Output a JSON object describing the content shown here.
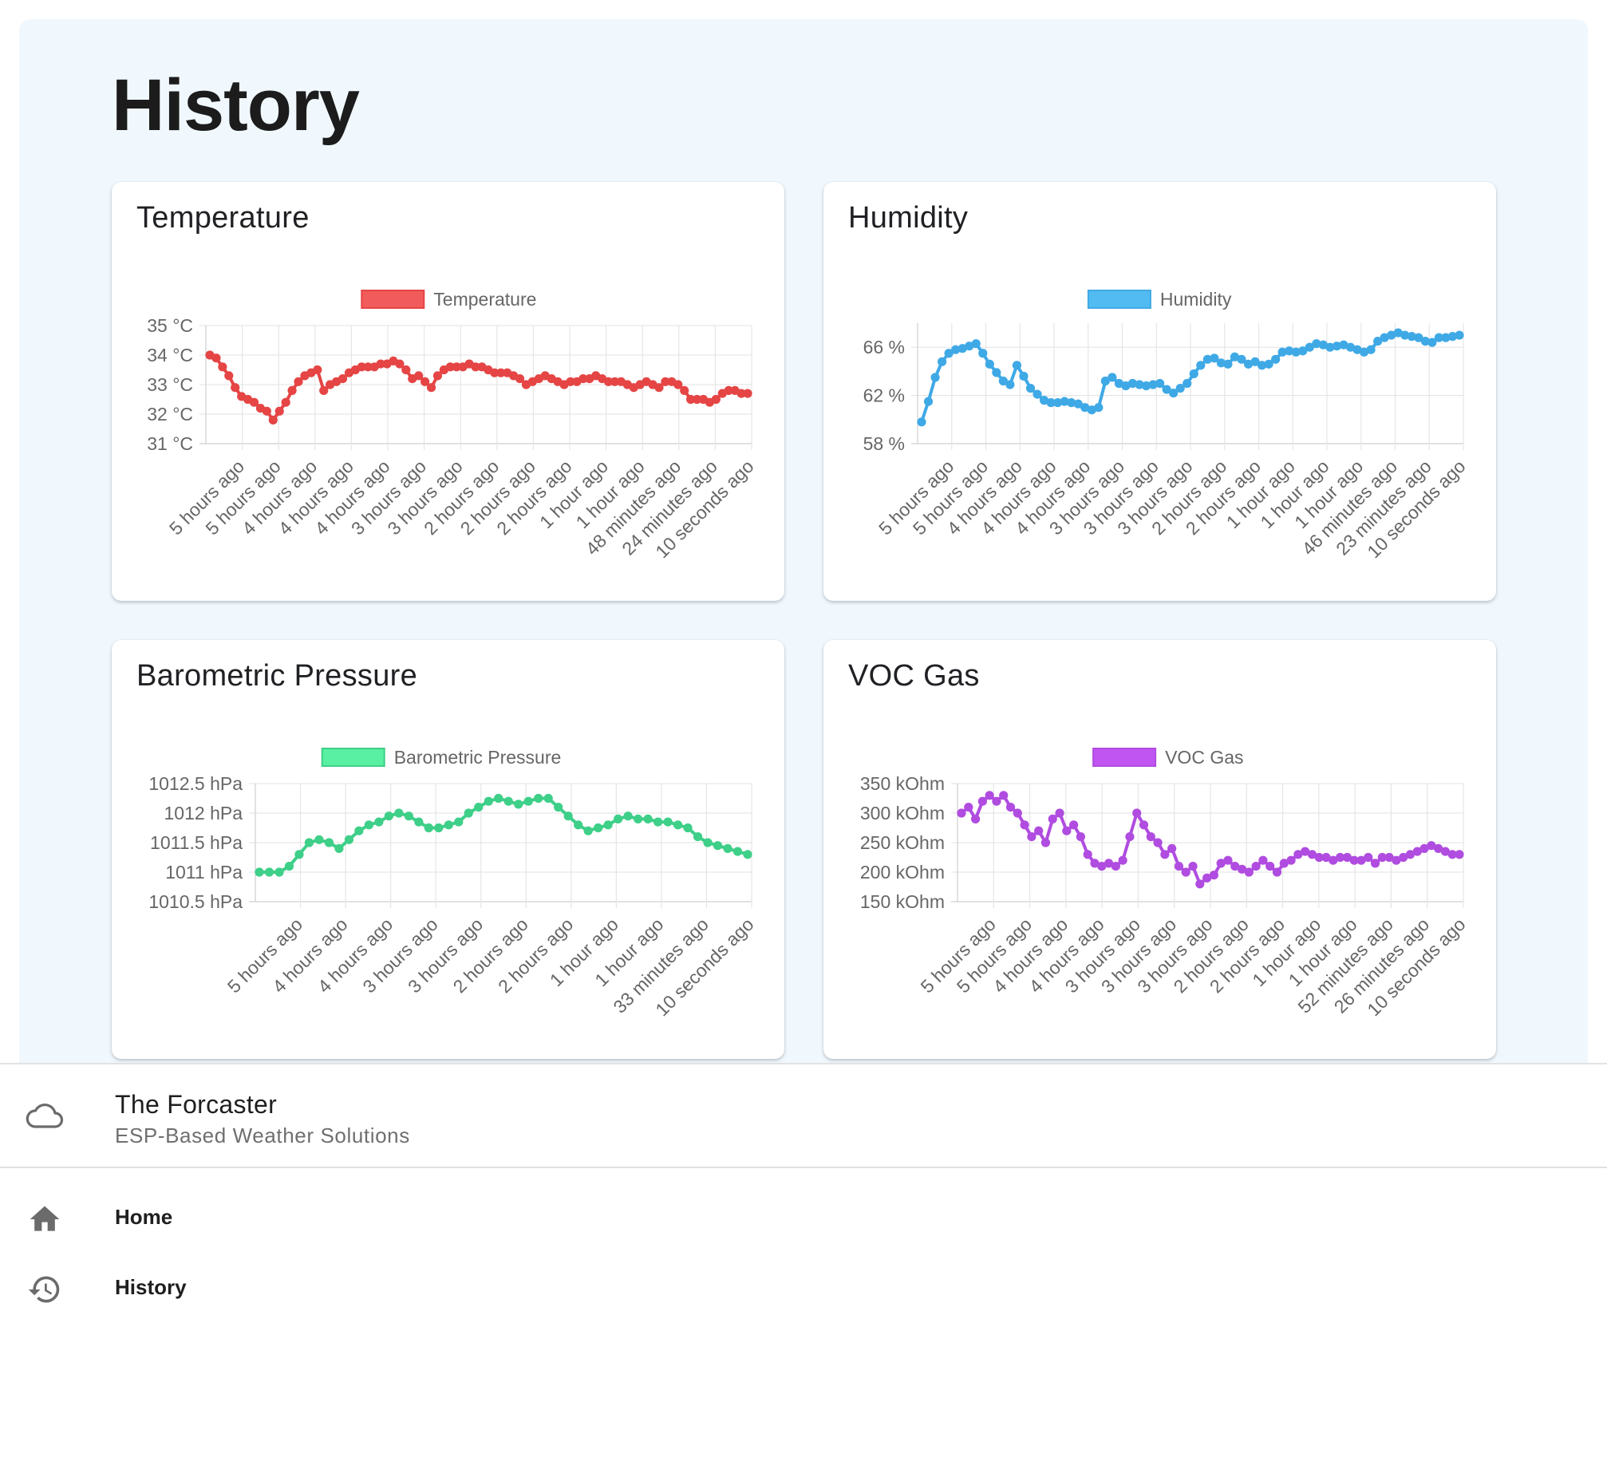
{
  "page": {
    "title": "History"
  },
  "charts": [
    {
      "id": "temperature",
      "card_title": "Temperature",
      "color": "#e54545",
      "legend_fill": "#f25b5b",
      "chart_data": {
        "type": "line",
        "title": "Temperature",
        "series": [
          {
            "name": "Temperature",
            "values": [
              34.0,
              33.9,
              33.6,
              33.3,
              32.9,
              32.6,
              32.5,
              32.4,
              32.2,
              32.1,
              31.8,
              32.1,
              32.4,
              32.8,
              33.1,
              33.3,
              33.4,
              33.5,
              32.8,
              33.0,
              33.1,
              33.2,
              33.4,
              33.5,
              33.6,
              33.6,
              33.6,
              33.7,
              33.7,
              33.8,
              33.7,
              33.5,
              33.2,
              33.3,
              33.1,
              32.9,
              33.3,
              33.5,
              33.6,
              33.6,
              33.6,
              33.7,
              33.6,
              33.6,
              33.5,
              33.4,
              33.4,
              33.4,
              33.3,
              33.2,
              33.0,
              33.1,
              33.2,
              33.3,
              33.2,
              33.1,
              33.0,
              33.1,
              33.1,
              33.2,
              33.2,
              33.3,
              33.2,
              33.1,
              33.1,
              33.1,
              33.0,
              32.9,
              33.0,
              33.1,
              33.0,
              32.9,
              33.1,
              33.1,
              33.0,
              32.8,
              32.5,
              32.5,
              32.5,
              32.4,
              32.5,
              32.7,
              32.8,
              32.8,
              32.7,
              32.7
            ]
          }
        ],
        "x_tick_labels": [
          "5 hours ago",
          "5 hours ago",
          "4 hours ago",
          "4 hours ago",
          "4 hours ago",
          "3 hours ago",
          "3 hours ago",
          "2 hours ago",
          "2 hours ago",
          "2 hours ago",
          "1 hour ago",
          "1 hour ago",
          "48 minutes ago",
          "24 minutes ago",
          "10 seconds ago"
        ],
        "y_ticks": [
          31,
          32,
          33,
          34,
          35
        ],
        "y_tick_labels": [
          "31 °C",
          "32 °C",
          "33 °C",
          "34 °C",
          "35 °C"
        ],
        "ylim": [
          31,
          35
        ],
        "grid": true,
        "legend": "top"
      }
    },
    {
      "id": "humidity",
      "card_title": "Humidity",
      "color": "#3fa9e6",
      "legend_fill": "#52bcf2",
      "chart_data": {
        "type": "line",
        "title": "Humidity",
        "series": [
          {
            "name": "Humidity",
            "values": [
              59.8,
              61.5,
              63.5,
              64.8,
              65.5,
              65.8,
              65.9,
              66.1,
              66.3,
              65.5,
              64.6,
              63.9,
              63.2,
              62.9,
              64.5,
              63.6,
              62.6,
              62.1,
              61.6,
              61.4,
              61.4,
              61.5,
              61.4,
              61.3,
              61.0,
              60.8,
              61.0,
              63.2,
              63.5,
              63.0,
              62.8,
              63.0,
              62.9,
              62.8,
              62.9,
              63.0,
              62.5,
              62.2,
              62.6,
              63.0,
              63.8,
              64.5,
              65.0,
              65.1,
              64.7,
              64.6,
              65.2,
              65.0,
              64.6,
              64.8,
              64.5,
              64.6,
              65.0,
              65.6,
              65.7,
              65.6,
              65.7,
              66.0,
              66.3,
              66.2,
              66.0,
              66.1,
              66.2,
              66.0,
              65.8,
              65.6,
              65.8,
              66.5,
              66.8,
              67.0,
              67.2,
              67.0,
              66.9,
              66.8,
              66.5,
              66.4,
              66.8,
              66.8,
              66.9,
              67.0
            ]
          }
        ],
        "x_tick_labels": [
          "5 hours ago",
          "5 hours ago",
          "4 hours ago",
          "4 hours ago",
          "4 hours ago",
          "3 hours ago",
          "3 hours ago",
          "3 hours ago",
          "2 hours ago",
          "2 hours ago",
          "1 hour ago",
          "1 hour ago",
          "1 hour ago",
          "46 minutes ago",
          "23 minutes ago",
          "10 seconds ago"
        ],
        "y_ticks": [
          58,
          62,
          66
        ],
        "y_tick_labels": [
          "58 %",
          "62 %",
          "66 %"
        ],
        "ylim": [
          58,
          68
        ],
        "grid": true,
        "legend": "top"
      }
    },
    {
      "id": "pressure",
      "card_title": "Barometric Pressure",
      "color": "#3ecf88",
      "legend_fill": "#59f0a3",
      "chart_data": {
        "type": "line",
        "title": "Barometric Pressure",
        "series": [
          {
            "name": "Barometric Pressure",
            "values": [
              1011.0,
              1011.0,
              1011.0,
              1011.1,
              1011.3,
              1011.5,
              1011.55,
              1011.5,
              1011.4,
              1011.55,
              1011.7,
              1011.8,
              1011.85,
              1011.95,
              1012.0,
              1011.95,
              1011.85,
              1011.75,
              1011.75,
              1011.8,
              1011.85,
              1012.0,
              1012.1,
              1012.2,
              1012.25,
              1012.2,
              1012.15,
              1012.2,
              1012.25,
              1012.25,
              1012.1,
              1011.95,
              1011.8,
              1011.7,
              1011.75,
              1011.8,
              1011.9,
              1011.95,
              1011.9,
              1011.9,
              1011.85,
              1011.85,
              1011.8,
              1011.75,
              1011.6,
              1011.5,
              1011.45,
              1011.4,
              1011.35,
              1011.3
            ]
          }
        ],
        "x_tick_labels": [
          "5 hours ago",
          "4 hours ago",
          "4 hours ago",
          "3 hours ago",
          "3 hours ago",
          "2 hours ago",
          "2 hours ago",
          "1 hour ago",
          "1 hour ago",
          "33 minutes ago",
          "10 seconds ago"
        ],
        "y_ticks": [
          1010.5,
          1011,
          1011.5,
          1012,
          1012.5
        ],
        "y_tick_labels": [
          "1010.5 hPa",
          "1011 hPa",
          "1011.5 hPa",
          "1012 hPa",
          "1012.5 hPa"
        ],
        "ylim": [
          1010.5,
          1012.5
        ],
        "grid": true,
        "legend": "top"
      }
    },
    {
      "id": "voc",
      "card_title": "VOC Gas",
      "color": "#b04ce0",
      "legend_fill": "#c055f2",
      "chart_data": {
        "type": "line",
        "title": "VOC Gas",
        "series": [
          {
            "name": "VOC Gas",
            "values": [
              300,
              310,
              290,
              320,
              330,
              320,
              330,
              310,
              300,
              280,
              260,
              270,
              250,
              290,
              300,
              270,
              280,
              260,
              230,
              215,
              210,
              215,
              210,
              220,
              260,
              300,
              280,
              260,
              250,
              230,
              240,
              210,
              200,
              210,
              180,
              190,
              195,
              215,
              220,
              210,
              205,
              200,
              210,
              220,
              210,
              200,
              215,
              220,
              230,
              235,
              230,
              225,
              225,
              220,
              225,
              225,
              220,
              220,
              225,
              215,
              225,
              225,
              220,
              225,
              230,
              235,
              240,
              245,
              240,
              235,
              230,
              230
            ]
          }
        ],
        "x_tick_labels": [
          "5 hours ago",
          "5 hours ago",
          "4 hours ago",
          "4 hours ago",
          "3 hours ago",
          "3 hours ago",
          "3 hours ago",
          "2 hours ago",
          "2 hours ago",
          "1 hour ago",
          "1 hour ago",
          "52 minutes ago",
          "26 minutes ago",
          "10 seconds ago"
        ],
        "y_ticks": [
          150,
          200,
          250,
          300,
          350
        ],
        "y_tick_labels": [
          "150 kOhm",
          "200 kOhm",
          "250 kOhm",
          "300 kOhm",
          "350 kOhm"
        ],
        "ylim": [
          150,
          350
        ],
        "grid": true,
        "legend": "top"
      }
    }
  ],
  "drawer": {
    "app_name": "The Forcaster",
    "app_subtitle": "ESP-Based Weather Solutions",
    "app_icon": "cloud-icon",
    "nav": [
      {
        "label": "Home",
        "icon": "home-icon"
      },
      {
        "label": "History",
        "icon": "history-icon"
      }
    ]
  }
}
